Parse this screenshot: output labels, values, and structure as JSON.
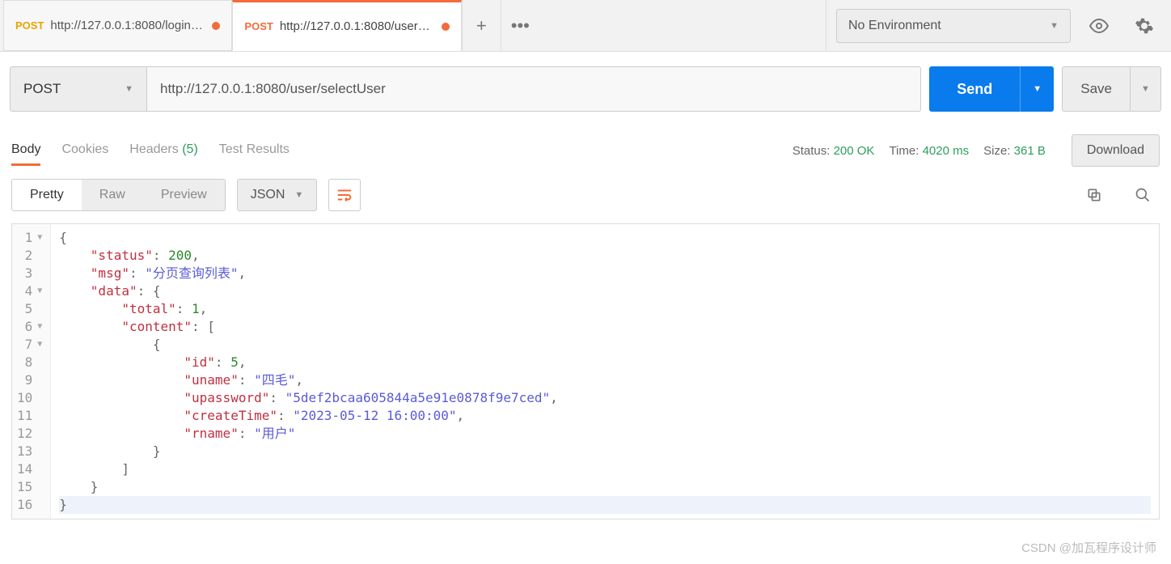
{
  "tabs": [
    {
      "method": "POST",
      "title": "http://127.0.0.1:8080/login/user",
      "active": false,
      "dirty": true
    },
    {
      "method": "POST",
      "title": "http://127.0.0.1:8080/user/selec",
      "active": true,
      "dirty": true
    }
  ],
  "env": {
    "label": "No Environment"
  },
  "request": {
    "method": "POST",
    "url": "http://127.0.0.1:8080/user/selectUser"
  },
  "actions": {
    "send": "Send",
    "save": "Save"
  },
  "response_tabs": {
    "body": "Body",
    "cookies": "Cookies",
    "headers": "Headers",
    "headers_count": "(5)",
    "test": "Test Results"
  },
  "meta": {
    "status_label": "Status:",
    "status": "200 OK",
    "time_label": "Time:",
    "time": "4020 ms",
    "size_label": "Size:",
    "size": "361 B",
    "download": "Download"
  },
  "views": {
    "pretty": "Pretty",
    "raw": "Raw",
    "preview": "Preview",
    "format": "JSON"
  },
  "json_body": {
    "status": 200,
    "msg": "分页查询列表",
    "data": {
      "total": 1,
      "content": [
        {
          "id": 5,
          "uname": "四毛",
          "upassword": "5def2bcaa605844a5e91e0878f9e7ced",
          "createTime": "2023-05-12 16:00:00",
          "rname": "用户"
        }
      ]
    }
  },
  "lines": {
    "start": 1,
    "end": 16
  },
  "watermark": "CSDN @加瓦程序设计师"
}
